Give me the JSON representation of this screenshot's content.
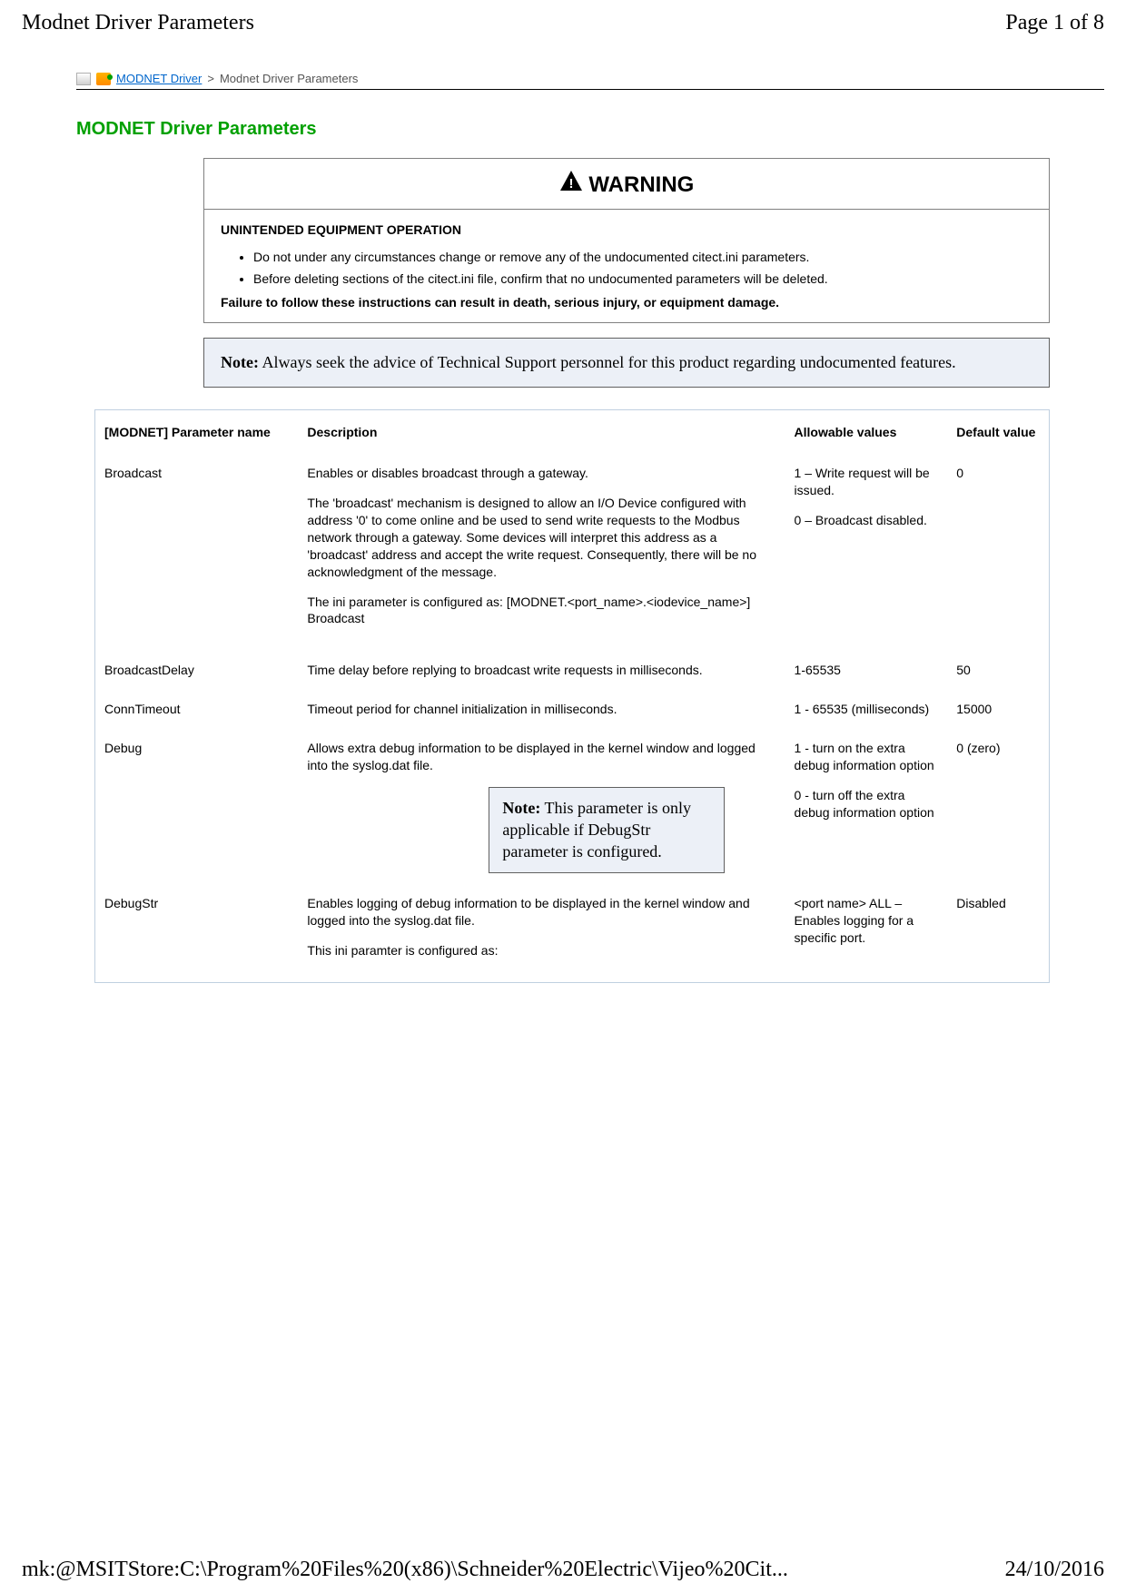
{
  "header": {
    "left": "Modnet Driver Parameters",
    "right": "Page 1 of 8"
  },
  "breadcrumb": {
    "link": "MODNET Driver",
    "sep": ">",
    "current": "Modnet Driver Parameters"
  },
  "title": "MODNET Driver Parameters",
  "warning": {
    "header_symbol": "▲",
    "header_text": "WARNING",
    "subhead": "UNINTENDED EQUIPMENT OPERATION",
    "bullets": [
      "Do not under any circumstances change or remove any of the undocumented citect.ini parameters.",
      "Before deleting sections of the citect.ini file, confirm that no undocumented parameters will be deleted."
    ],
    "failure": "Failure to follow these instructions can result in death, serious injury, or equipment damage."
  },
  "note": {
    "label": "Note:",
    "text": " Always seek the advice of Technical Support personnel for this product regarding undocumented features."
  },
  "table": {
    "headers": {
      "name": "[MODNET] Parameter name",
      "desc": "Description",
      "allow": "Allowable values",
      "def": "Default value"
    },
    "rows": {
      "broadcast": {
        "name": "Broadcast",
        "d1": "Enables or disables broadcast through a gateway.",
        "d2": "The 'broadcast' mechanism is designed to allow an I/O Device configured with address '0' to come online and be used to send write requests to the Modbus network through a gateway. Some devices will interpret this address as a 'broadcast' address and accept the write request. Consequently, there will be no acknowledgment of the message.",
        "d3": "The ini parameter is configured as: [MODNET.<port_name>.<iodevice_name>] Broadcast",
        "a1": "1 – Write request will be issued.",
        "a2": "0 – Broadcast disabled.",
        "def": "0"
      },
      "broadcastdelay": {
        "name": "BroadcastDelay",
        "d1": "Time delay before replying to broadcast write requests in milliseconds.",
        "a1": "1-65535",
        "def": "50"
      },
      "conntimeout": {
        "name": "ConnTimeout",
        "d1": "Timeout period for channel initialization in milliseconds.",
        "a1": "1 - 65535 (milliseconds)",
        "def": "15000"
      },
      "debug": {
        "name": "Debug",
        "d1": "Allows extra debug information to be displayed in the kernel window and logged into the syslog.dat file.",
        "note_label": "Note:",
        "note_text": " This parameter is only applicable if DebugStr parameter is configured.",
        "a1": "1 - turn on the extra debug information option",
        "a2": "0 - turn off the extra debug information option",
        "def": "0 (zero)"
      },
      "debugstr": {
        "name": "DebugStr",
        "d1": "Enables logging of debug information to be displayed in the kernel window and logged into the syslog.dat file.",
        "d2": "This ini paramter is configured as:",
        "a1": "<port name> ALL – Enables logging for a specific port.",
        "def": "Disabled"
      }
    }
  },
  "footer": {
    "left": "mk:@MSITStore:C:\\Program%20Files%20(x86)\\Schneider%20Electric\\Vijeo%20Cit...",
    "right": "24/10/2016"
  }
}
